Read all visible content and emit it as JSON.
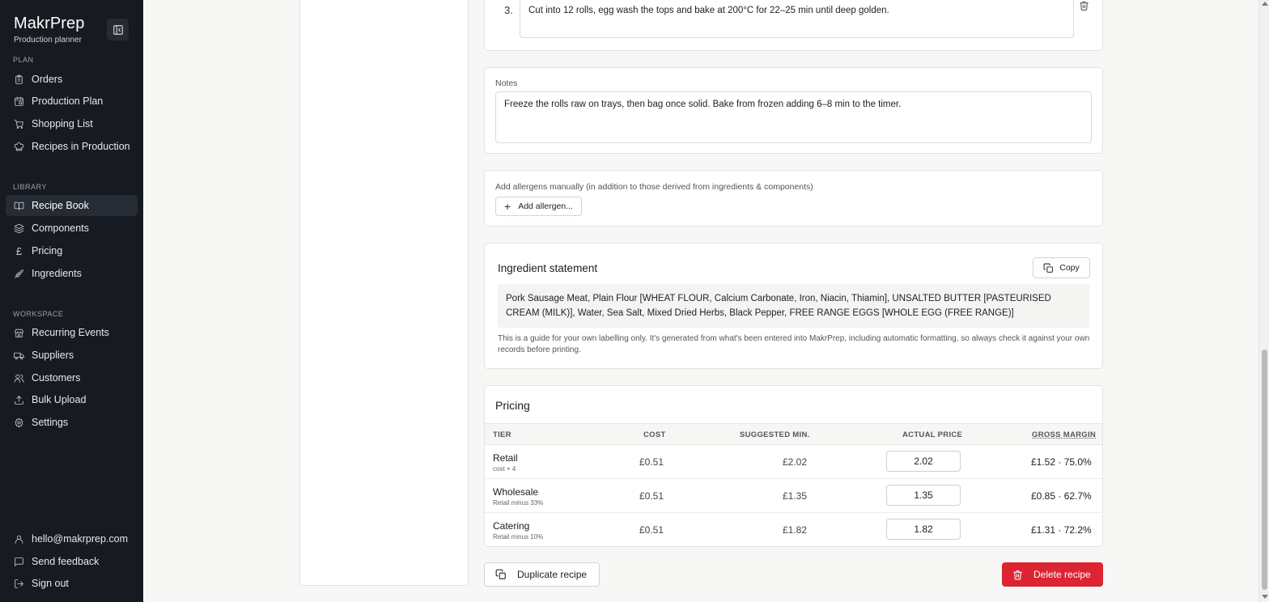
{
  "app": {
    "name": "MakrPrep",
    "subtitle": "Production planner"
  },
  "sidebar": {
    "plan_label": "PLAN",
    "plan_items": [
      {
        "label": "Orders",
        "icon": "clipboard-icon"
      },
      {
        "label": "Production Plan",
        "icon": "calendar-clock-icon"
      },
      {
        "label": "Shopping List",
        "icon": "cart-icon"
      },
      {
        "label": "Recipes in Production",
        "icon": "chef-hat-icon"
      }
    ],
    "library_label": "LIBRARY",
    "library_items": [
      {
        "label": "Recipe Book",
        "icon": "book-open-icon",
        "active": true
      },
      {
        "label": "Components",
        "icon": "layers-icon"
      },
      {
        "label": "Pricing",
        "icon": "pound-icon"
      },
      {
        "label": "Ingredients",
        "icon": "wheat-icon"
      }
    ],
    "workspace_label": "WORKSPACE",
    "workspace_items": [
      {
        "label": "Recurring Events",
        "icon": "store-icon"
      },
      {
        "label": "Suppliers",
        "icon": "truck-icon"
      },
      {
        "label": "Customers",
        "icon": "users-icon"
      },
      {
        "label": "Bulk Upload",
        "icon": "upload-icon"
      },
      {
        "label": "Settings",
        "icon": "gear-icon"
      }
    ],
    "footer": {
      "email": "hello@makrprep.com",
      "feedback": "Send feedback",
      "signout": "Sign out"
    }
  },
  "method": {
    "step_number": "3.",
    "step_text": "Cut into 12 rolls, egg wash the tops and bake at 200°C for 22–25 min until deep golden."
  },
  "notes": {
    "label": "Notes",
    "value": "Freeze the rolls raw on trays, then bag once solid. Bake from frozen adding 6–8 min to the timer."
  },
  "allergens": {
    "label": "Add allergens manually (in addition to those derived from ingredients & components)",
    "button": "Add allergen..."
  },
  "statement": {
    "title": "Ingredient statement",
    "copy_label": "Copy",
    "text": "Pork Sausage Meat, Plain Flour [WHEAT FLOUR, Calcium Carbonate, Iron, Niacin, Thiamin], UNSALTED BUTTER [PASTEURISED CREAM (MILK)], Water, Sea Salt, Mixed Dried Herbs, Black Pepper, FREE RANGE EGGS [WHOLE EGG (FREE RANGE)]",
    "disclaimer": "This is a guide for your own labelling only. It's generated from what's been entered into MakrPrep, including automatic formatting, so always check it against your own records before printing."
  },
  "pricing": {
    "title": "Pricing",
    "headers": {
      "tier": "TIER",
      "cost": "COST",
      "suggested": "SUGGESTED MIN.",
      "actual": "ACTUAL PRICE",
      "margin": "GROSS MARGIN"
    },
    "rows": [
      {
        "tier": "Retail",
        "sub": "cost × 4",
        "cost": "£0.51",
        "suggested": "£2.02",
        "actual": "2.02",
        "margin": "£1.52 · 75.0%"
      },
      {
        "tier": "Wholesale",
        "sub": "Retail minus 33%",
        "cost": "£0.51",
        "suggested": "£1.35",
        "actual": "1.35",
        "margin": "£0.85 · 62.7%"
      },
      {
        "tier": "Catering",
        "sub": "Retail minus 10%",
        "cost": "£0.51",
        "suggested": "£1.82",
        "actual": "1.82",
        "margin": "£1.31 · 72.2%"
      }
    ]
  },
  "actions": {
    "duplicate": "Duplicate recipe",
    "delete": "Delete recipe"
  },
  "colors": {
    "sidebar_bg": "#171b21",
    "danger": "#dc2433",
    "accent_active": "#262c35"
  }
}
